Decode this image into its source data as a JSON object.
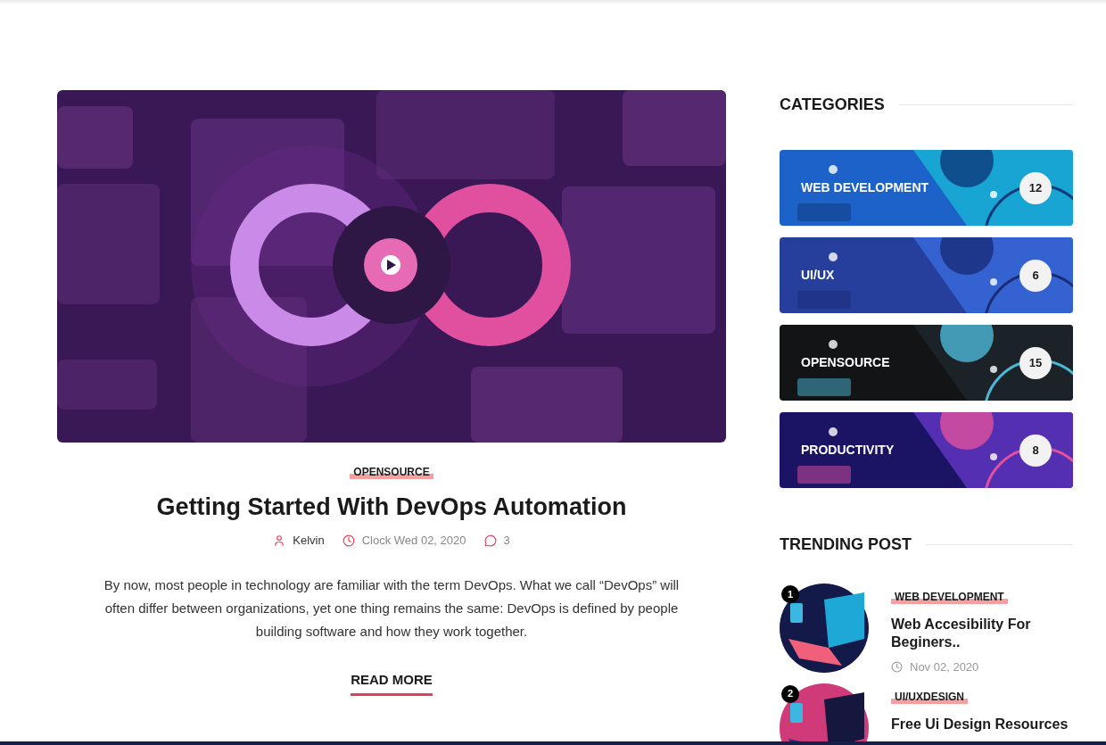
{
  "article": {
    "category": "OPENSOURCE",
    "title": "Getting Started With DevOps Automation",
    "author": "Kelvin",
    "date": "Clock Wed 02, 2020",
    "comments": "3",
    "excerpt": "By now, most people in technology are familiar with the term DevOps. What we call “DevOps” will often differ between organizations, yet one thing remains the same: DevOps is defined by people building software and how they work together.",
    "read_more": "READ MORE"
  },
  "categories": {
    "heading": "CATEGORIES",
    "items": [
      {
        "name": "WEB DEVELOPMENT",
        "count": "12"
      },
      {
        "name": "UI/UX",
        "count": "6"
      },
      {
        "name": "OPENSOURCE",
        "count": "15"
      },
      {
        "name": "PRODUCTIVITY",
        "count": "8"
      }
    ]
  },
  "trending": {
    "heading": "TRENDING POST",
    "posts": [
      {
        "rank": "1",
        "category": "WEB DEVELOPMENT",
        "title": "Web Accesibility For Beginers..",
        "date": "Nov 02, 2020"
      },
      {
        "rank": "2",
        "category": "UI/UXDESIGN",
        "title": "Free Ui Design Resources"
      }
    ]
  }
}
